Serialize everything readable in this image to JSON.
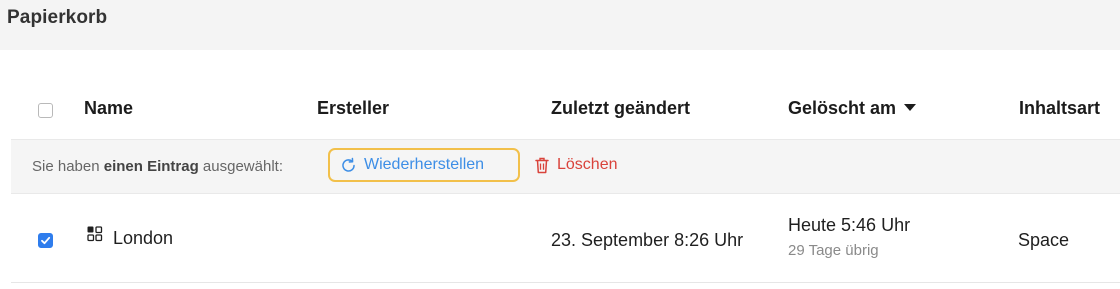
{
  "page": {
    "title": "Papierkorb"
  },
  "table": {
    "columns": {
      "name": "Name",
      "creator": "Ersteller",
      "modified": "Zuletzt geändert",
      "deleted": "Gelöscht am",
      "content_type": "Inhaltsart"
    },
    "sort": {
      "column": "deleted",
      "direction": "descending",
      "icon": "caret-down-icon"
    }
  },
  "selection_bar": {
    "prefix": "Sie haben ",
    "count_text": "einen Eintrag",
    "suffix": " ausgewählt:",
    "restore_label": "Wiederherstellen",
    "restore_icon": "refresh-icon",
    "delete_label": "Löschen",
    "delete_icon": "trash-icon",
    "colors": {
      "restore": "#3d8ee6",
      "delete": "#d9433b",
      "highlight": "#f2c04a"
    }
  },
  "rows": [
    {
      "selected": true,
      "icon": "space-grid-icon",
      "name": "London",
      "creator": "",
      "modified": "23. September 8:26 Uhr",
      "deleted": "Heute 5:46 Uhr",
      "remaining": "29 Tage übrig",
      "content_type": "Space"
    }
  ],
  "colors": {
    "accent": "#2f7ded"
  }
}
